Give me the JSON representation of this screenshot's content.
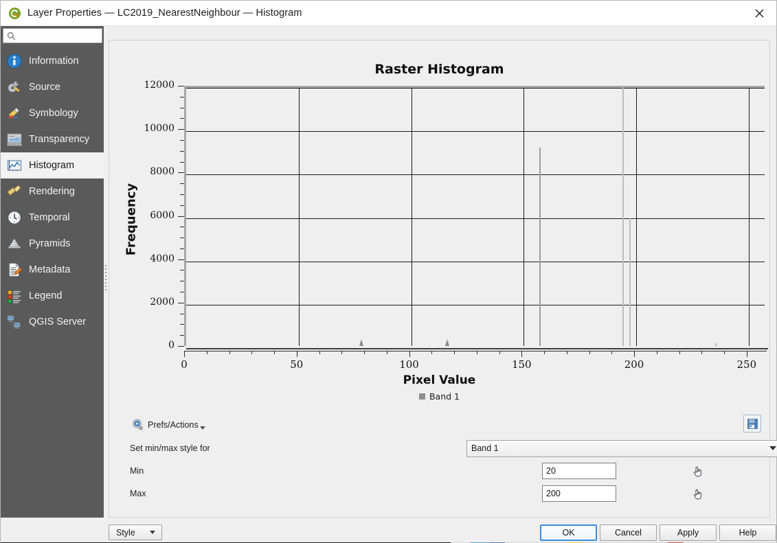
{
  "window": {
    "title": "Layer Properties — LC2019_NearestNeighbour — Histogram",
    "logo_icon": "qgis-logo-icon",
    "close_icon": "close-icon"
  },
  "sidebar": {
    "search": {
      "value": "",
      "placeholder": "",
      "icon": "search-icon"
    },
    "items": [
      {
        "label": "Information",
        "icon": "information-icon",
        "selected": false
      },
      {
        "label": "Source",
        "icon": "source-wrench-icon",
        "selected": false
      },
      {
        "label": "Symbology",
        "icon": "symbology-brush-icon",
        "selected": false
      },
      {
        "label": "Transparency",
        "icon": "transparency-icon",
        "selected": false
      },
      {
        "label": "Histogram",
        "icon": "histogram-icon",
        "selected": true
      },
      {
        "label": "Rendering",
        "icon": "rendering-brush-icon",
        "selected": false
      },
      {
        "label": "Temporal",
        "icon": "clock-icon",
        "selected": false
      },
      {
        "label": "Pyramids",
        "icon": "pyramids-icon",
        "selected": false
      },
      {
        "label": "Metadata",
        "icon": "metadata-document-icon",
        "selected": false
      },
      {
        "label": "Legend",
        "icon": "legend-list-icon",
        "selected": false
      },
      {
        "label": "QGIS Server",
        "icon": "qgis-server-icon",
        "selected": false
      }
    ]
  },
  "chart_data": {
    "type": "bar",
    "title": "Raster Histogram",
    "xlabel": "Pixel Value",
    "ylabel": "Frequency",
    "xlim": [
      0,
      258
    ],
    "ylim": [
      0,
      12000
    ],
    "grid": true,
    "x_ticks": [
      0,
      50,
      100,
      150,
      200,
      250
    ],
    "x_tick_labels": [
      "0",
      "50",
      "100",
      "150",
      "200",
      "250"
    ],
    "x_minor_tick_step": 10,
    "y_ticks": [
      0,
      2000,
      4000,
      6000,
      8000,
      10000,
      12000
    ],
    "y_tick_labels": [
      "0",
      "2000",
      "4000",
      "6000",
      "8000",
      "10000",
      "12000"
    ],
    "y_minor_tick_step": 500,
    "legend": {
      "entries": [
        "Band 1"
      ],
      "position": "below",
      "swatch_color": "#8f8f8f"
    },
    "series": [
      {
        "name": "Band 1",
        "color": "#9e9e9e",
        "points": [
          {
            "x": 78,
            "y": 320,
            "width": 2,
            "style": "triangle"
          },
          {
            "x": 116,
            "y": 300,
            "width": 2,
            "style": "triangle"
          },
          {
            "x": 157,
            "y": 9150,
            "width": 2,
            "style": "bar"
          },
          {
            "x": 194,
            "y": 11960,
            "width": 2,
            "style": "bar-light"
          },
          {
            "x": 197,
            "y": 5900,
            "width": 2,
            "style": "bar-light"
          },
          {
            "x": 235,
            "y": 120,
            "width": 3,
            "style": "faint"
          }
        ]
      }
    ]
  },
  "controls": {
    "prefs_actions": {
      "label": "Prefs/Actions",
      "icon": "prefs-actions-icon"
    },
    "save_button": {
      "icon": "save-floppy-icon",
      "tooltip": ""
    },
    "minmax_style": {
      "label": "Set min/max style for",
      "value": "Band 1",
      "options": [
        "Band 1"
      ]
    },
    "min": {
      "label": "Min",
      "value": "20",
      "picker_icon": "pick-hand-icon"
    },
    "max": {
      "label": "Max",
      "value": "200",
      "picker_icon": "pick-hand-icon"
    }
  },
  "footer": {
    "style_button": {
      "label": "Style"
    },
    "buttons": [
      {
        "label": "OK",
        "default": true
      },
      {
        "label": "Cancel",
        "default": false
      },
      {
        "label": "Apply",
        "default": false
      },
      {
        "label": "Help",
        "default": false
      }
    ]
  }
}
